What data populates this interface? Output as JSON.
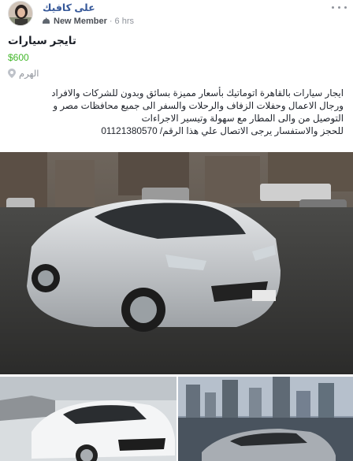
{
  "post": {
    "author_name": "على كافيك",
    "member_label": "New Member",
    "separator": "·",
    "time": "6 hrs"
  },
  "listing": {
    "title": "تايجر سيارات",
    "price": "$600",
    "location": "الهرم",
    "description_lines": [
      "ايجار سيارات بالقاهرة اتوماتيك بأسعار مميزة بسائق وبدون للشركات والافراد",
      "ورجال الاعمال وحفلات الزفاف والرحلات والسفر الى جميع محافظات مصر و",
      "التوصيل من والى المطار مع سهولة وتيسير الاجراءات",
      "للحجز والاستفسار يرجى الاتصال علي هذا الرقم/ 01121380570"
    ]
  },
  "icons": {
    "avatar": "profile-photo",
    "member_badge": "new-member-icon",
    "menu": "more-options-icon",
    "location": "location-pin-icon"
  },
  "colors": {
    "author": "#365899",
    "price": "#42b72a",
    "meta": "#90949c",
    "text": "#1d2129"
  }
}
